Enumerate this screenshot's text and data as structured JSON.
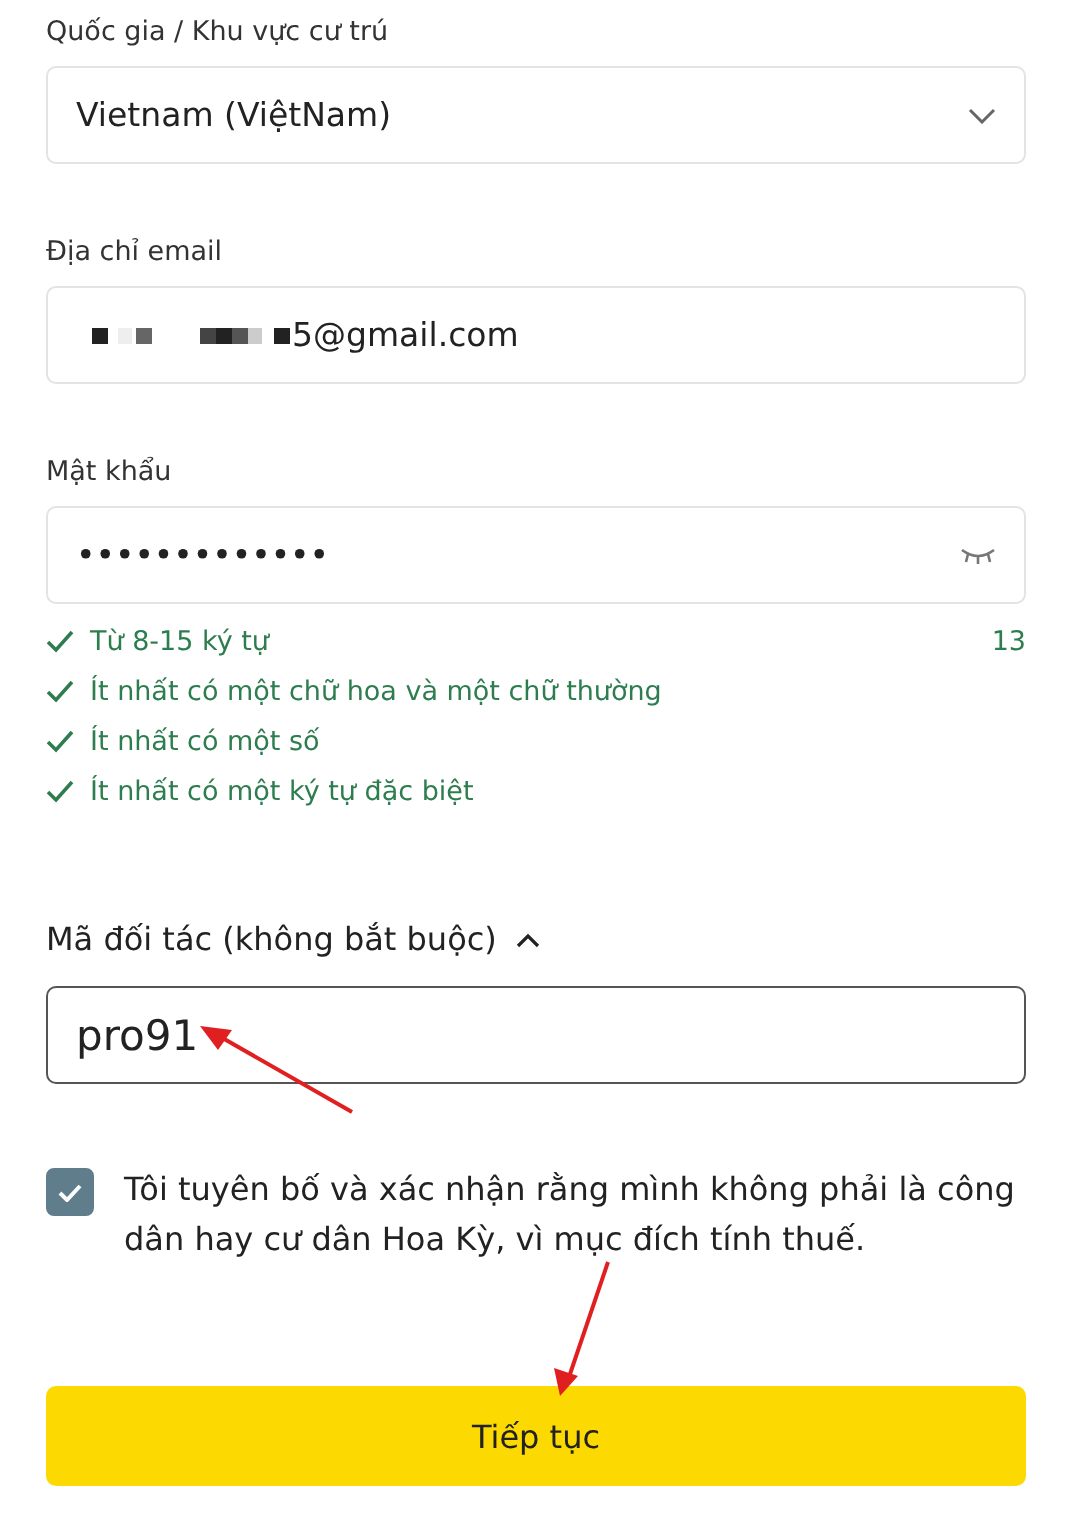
{
  "country": {
    "label": "Quốc gia / Khu vực cư trú",
    "value": "Vietnam (ViệtNam)"
  },
  "email": {
    "label": "Địa chỉ email",
    "value": "5@gmail.com",
    "redacted": true
  },
  "password": {
    "label": "Mật khẩu",
    "value": "•••••••••••••",
    "count": "13"
  },
  "rules": [
    {
      "text": "Từ 8-15 ký tự",
      "met": true
    },
    {
      "text": "Ít nhất có một chữ hoa và một chữ thường",
      "met": true
    },
    {
      "text": "Ít nhất có một số",
      "met": true
    },
    {
      "text": "Ít nhất có một ký tự đặc biệt",
      "met": true
    }
  ],
  "partner": {
    "label": "Mã đối tác (không bắt buộc)",
    "expanded": true,
    "value": "pro91"
  },
  "declaration": {
    "text": "Tôi tuyên bố và xác nhận rằng mình không phải là công dân hay cư dân Hoa Kỳ, vì mục đích tính thuế.",
    "checked": true
  },
  "submit": "Tiếp tục"
}
